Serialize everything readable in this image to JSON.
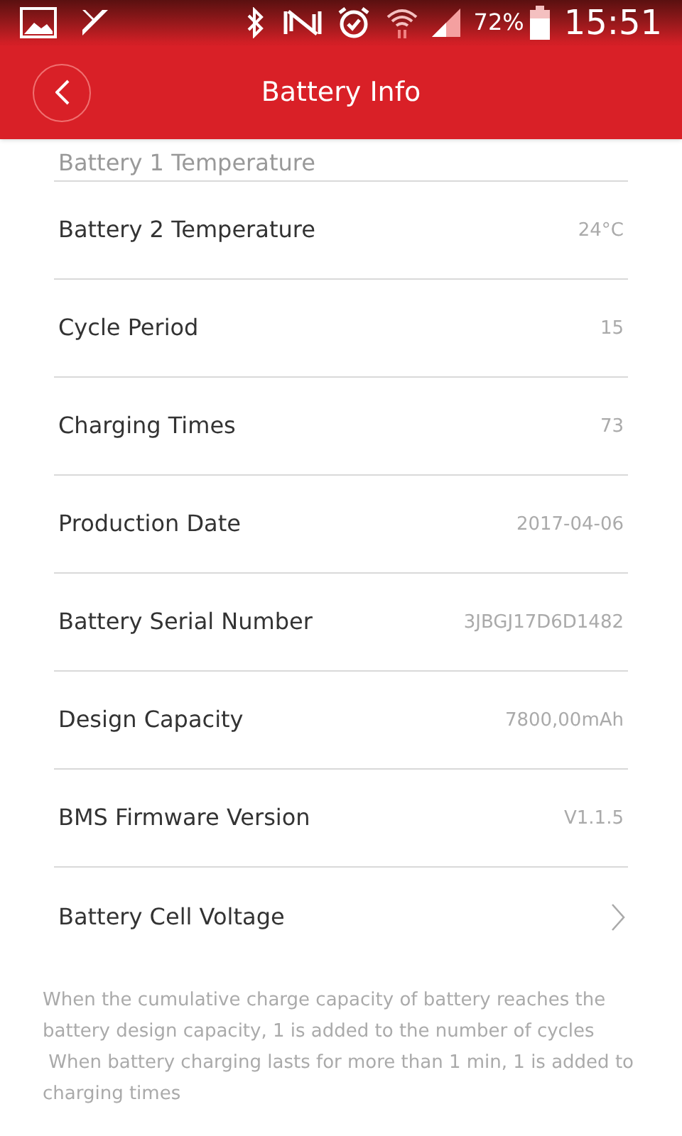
{
  "status_bar": {
    "battery_percent": "72%",
    "time": "15:51"
  },
  "header": {
    "title": "Battery Info"
  },
  "rows": [
    {
      "kind": "partial",
      "label": "Battery 1 Temperature"
    },
    {
      "kind": "value",
      "label": "Battery 2 Temperature",
      "value": "24°C"
    },
    {
      "kind": "value",
      "label": "Cycle Period",
      "value": "15"
    },
    {
      "kind": "value",
      "label": "Charging Times",
      "value": "73"
    },
    {
      "kind": "value",
      "label": "Production Date",
      "value": "2017-04-06"
    },
    {
      "kind": "value",
      "label": "Battery Serial Number",
      "value": "3JBGJ17D6D1482"
    },
    {
      "kind": "value",
      "label": "Design Capacity",
      "value": "7800,00mAh"
    },
    {
      "kind": "value",
      "label": "BMS Firmware Version",
      "value": "V1.1.5"
    },
    {
      "kind": "link",
      "label": "Battery Cell Voltage"
    }
  ],
  "notes": [
    "When the cumulative charge capacity of battery reaches the battery design capacity, 1 is added to the number of cycles",
    " When battery charging lasts for more than 1 min, 1 is added to charging times"
  ]
}
